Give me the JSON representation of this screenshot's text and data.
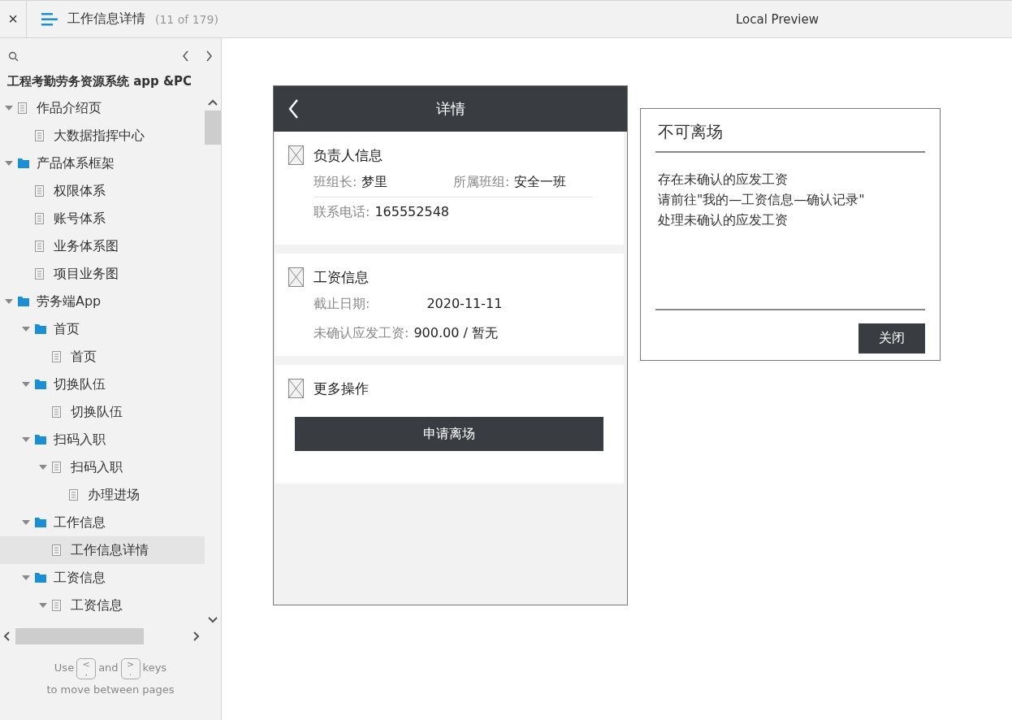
{
  "topbar": {
    "close": "×",
    "title": "工作信息详情",
    "count": "(11 of 179)",
    "preview": "Local Preview"
  },
  "sidebar": {
    "project": "工程考勤劳务资源系统 app &PC",
    "tree": [
      {
        "label": "作品介绍页",
        "kind": "page",
        "selected": false,
        "expanded": true,
        "children": [
          {
            "label": "大数据指挥中心",
            "kind": "page",
            "selected": false,
            "expanded": false
          }
        ]
      },
      {
        "label": "产品体系框架",
        "kind": "folder",
        "selected": false,
        "expanded": true,
        "children": [
          {
            "label": "权限体系",
            "kind": "page",
            "selected": false,
            "expanded": false
          },
          {
            "label": "账号体系",
            "kind": "page",
            "selected": false,
            "expanded": false
          },
          {
            "label": "业务体系图",
            "kind": "page",
            "selected": false,
            "expanded": false
          },
          {
            "label": "项目业务图",
            "kind": "page",
            "selected": false,
            "expanded": false
          }
        ]
      },
      {
        "label": "劳务端App",
        "kind": "folder",
        "selected": false,
        "expanded": true,
        "children": [
          {
            "label": "首页",
            "kind": "folder",
            "selected": false,
            "expanded": true,
            "children": [
              {
                "label": "首页",
                "kind": "page",
                "selected": false,
                "expanded": false
              }
            ]
          },
          {
            "label": "切换队伍",
            "kind": "folder",
            "selected": false,
            "expanded": true,
            "children": [
              {
                "label": "切换队伍",
                "kind": "page",
                "selected": false,
                "expanded": false
              }
            ]
          },
          {
            "label": "扫码入职",
            "kind": "folder",
            "selected": false,
            "expanded": true,
            "children": [
              {
                "label": "扫码入职",
                "kind": "page",
                "selected": false,
                "expanded": true,
                "children": [
                  {
                    "label": "办理进场",
                    "kind": "page",
                    "selected": false,
                    "expanded": false
                  }
                ]
              }
            ]
          },
          {
            "label": "工作信息",
            "kind": "folder",
            "selected": false,
            "expanded": true,
            "children": [
              {
                "label": "工作信息详情",
                "kind": "page",
                "selected": true,
                "expanded": false
              }
            ]
          },
          {
            "label": "工资信息",
            "kind": "folder",
            "selected": false,
            "expanded": true,
            "children": [
              {
                "label": "工资信息",
                "kind": "page",
                "selected": false,
                "expanded": true
              }
            ]
          }
        ]
      }
    ],
    "help": {
      "use": "Use",
      "prev_key": [
        "<",
        ","
      ],
      "and": "and",
      "next_key": [
        ">",
        "."
      ],
      "keys": "keys",
      "line2": "to move between pages"
    }
  },
  "phone": {
    "title": "详情",
    "sections": [
      {
        "kind": "info",
        "title": "负责人信息",
        "rows": [
          {
            "fields": [
              {
                "label": "班组长:",
                "value": "梦里"
              },
              {
                "label": "所属班组:",
                "value": "安全一班"
              }
            ]
          },
          {
            "fields": [
              {
                "label": "联系电话:",
                "value": "165552548"
              }
            ]
          }
        ]
      },
      {
        "kind": "info",
        "title": "工资信息",
        "rows": [
          {
            "fields": [
              {
                "label": "截止日期:",
                "value": "2020-11-11"
              }
            ]
          },
          {
            "fields": [
              {
                "label": "未确认应发工资:",
                "value": "900.00 / 暂无"
              }
            ]
          }
        ]
      },
      {
        "kind": "actions",
        "title": "更多操作",
        "button": "申请离场"
      }
    ]
  },
  "dialog": {
    "title": "不可离场",
    "lines": [
      "存在未确认的应发工资",
      "请前往\"我的—工资信息—确认记录\"",
      "处理未确认的应发工资"
    ],
    "button": "关闭"
  }
}
